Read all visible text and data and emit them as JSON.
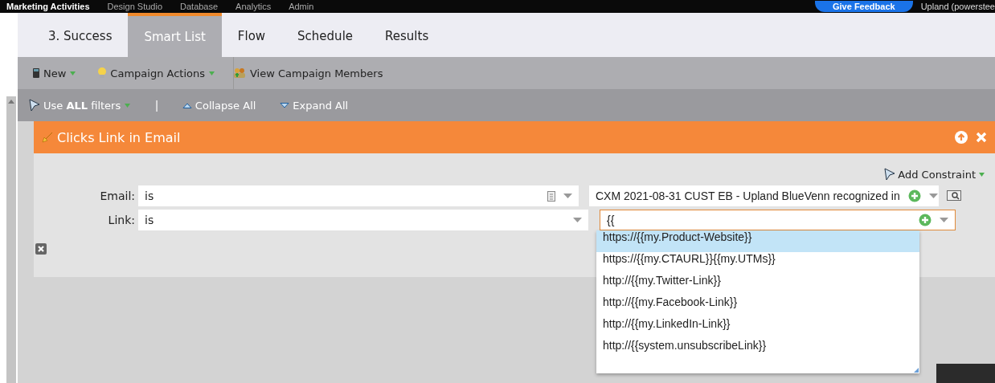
{
  "top_nav": {
    "items": [
      {
        "label": "Marketing Activities",
        "selected": true
      },
      {
        "label": "Design Studio",
        "selected": false
      },
      {
        "label": "Database",
        "selected": false
      },
      {
        "label": "Analytics",
        "selected": false
      },
      {
        "label": "Admin",
        "selected": false
      }
    ],
    "feedback_button": "Give Feedback",
    "account": "Upland (powerstee"
  },
  "tabs": [
    {
      "label": "3. Success",
      "selected": false
    },
    {
      "label": "Smart List",
      "selected": true
    },
    {
      "label": "Flow",
      "selected": false
    },
    {
      "label": "Schedule",
      "selected": false
    },
    {
      "label": "Results",
      "selected": false
    }
  ],
  "toolbar": [
    {
      "label": "New",
      "kind": "new",
      "menu": true
    },
    {
      "label": "Campaign Actions",
      "kind": "actions",
      "menu": true
    },
    {
      "label": "View Campaign Members",
      "kind": "members",
      "menu": false
    }
  ],
  "filter_bar": {
    "logic": "Use **ALL** filters",
    "separator": "|",
    "collapse": "Collapse All",
    "expand": "Expand All"
  },
  "filter": {
    "title": "Clicks Link in Email",
    "add_constraint": "Add Constraint",
    "rows": [
      {
        "kind": "email",
        "label": "Email:",
        "operator": "is",
        "value": "CXM 2021-08-31 CUST EB - Upland BlueVenn recognized in",
        "focused": false
      },
      {
        "kind": "link",
        "label": "Link:",
        "operator": "is",
        "value": "{{",
        "focused": true
      }
    ],
    "suggestions": [
      {
        "text": "https://{{my.Product-Website}}",
        "selected": true
      },
      {
        "text": "https://{{my.CTAURL}}{{my.UTMs}}",
        "selected": false
      },
      {
        "text": "http://{{my.Twitter-Link}}",
        "selected": false
      },
      {
        "text": "http://{{my.Facebook-Link}}",
        "selected": false
      },
      {
        "text": "http://{{my.LinkedIn-Link}}",
        "selected": false
      },
      {
        "text": "http://{{system.unsubscribeLink}}",
        "selected": false
      }
    ]
  }
}
